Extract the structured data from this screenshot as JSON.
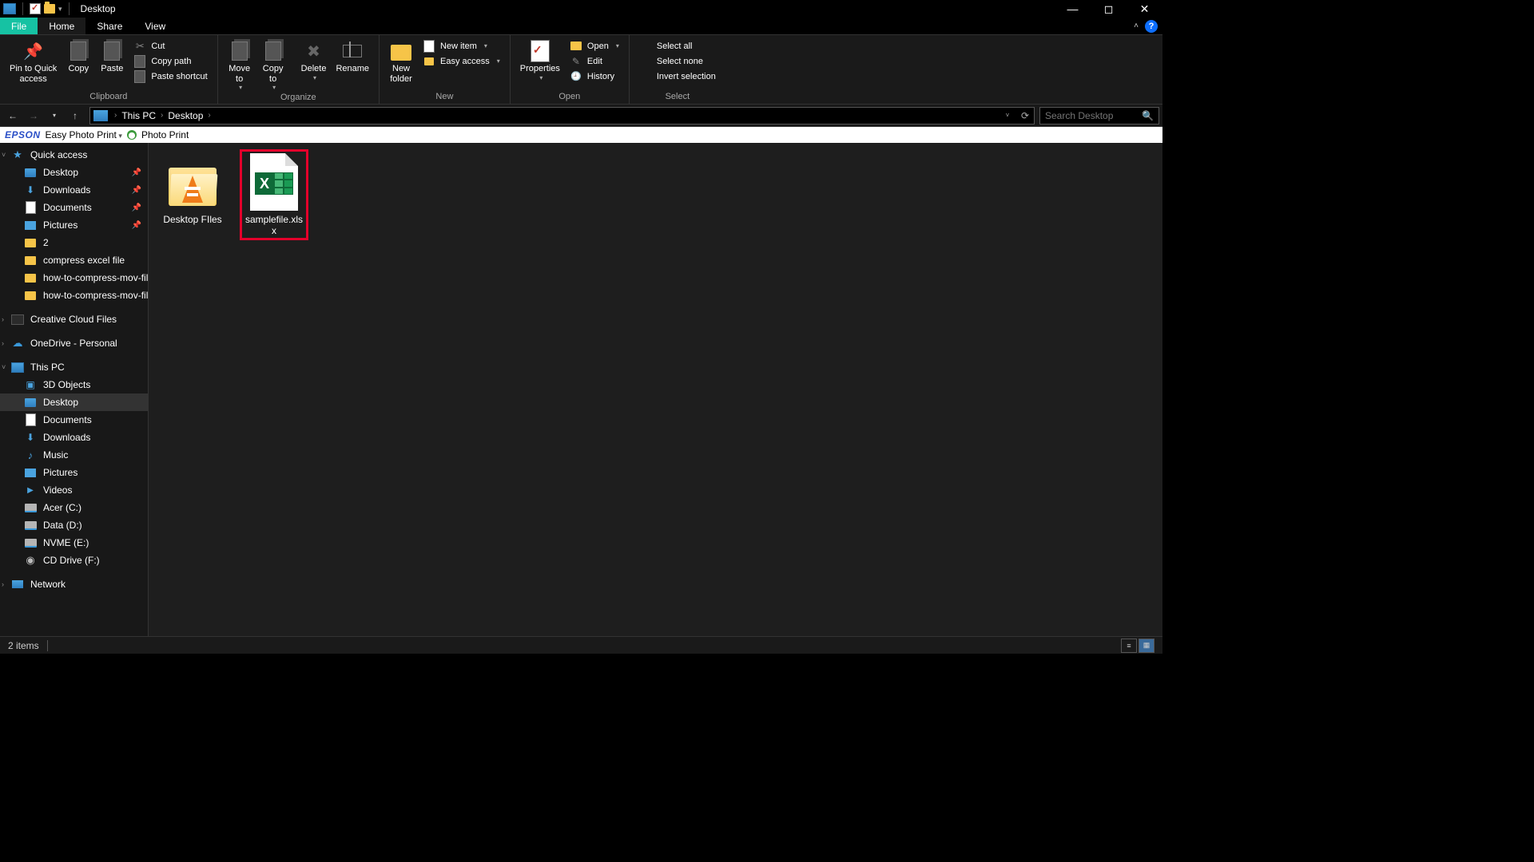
{
  "window": {
    "title": "Desktop"
  },
  "tabs": {
    "file": "File",
    "home": "Home",
    "share": "Share",
    "view": "View"
  },
  "ribbon": {
    "clipboard": {
      "label": "Clipboard",
      "pin": "Pin to Quick\naccess",
      "copy": "Copy",
      "paste": "Paste",
      "cut": "Cut",
      "copypath": "Copy path",
      "pasteshortcut": "Paste shortcut"
    },
    "organize": {
      "label": "Organize",
      "moveto": "Move\nto",
      "copyto": "Copy\nto",
      "delete": "Delete",
      "rename": "Rename"
    },
    "new": {
      "label": "New",
      "newfolder": "New\nfolder",
      "newitem": "New item",
      "easyaccess": "Easy access"
    },
    "open": {
      "label": "Open",
      "properties": "Properties",
      "open": "Open",
      "edit": "Edit",
      "history": "History"
    },
    "select": {
      "label": "Select",
      "all": "Select all",
      "none": "Select none",
      "invert": "Invert selection"
    }
  },
  "address": {
    "thispc": "This PC",
    "desktop": "Desktop",
    "search_placeholder": "Search Desktop"
  },
  "epson": {
    "brand": "EPSON",
    "easy": "Easy Photo Print",
    "print": "Photo Print"
  },
  "nav": {
    "quick": "Quick access",
    "desktop": "Desktop",
    "downloads": "Downloads",
    "documents": "Documents",
    "pictures": "Pictures",
    "two": "2",
    "compress": "compress excel file",
    "mov1": "how-to-compress-mov-file",
    "mov2": "how-to-compress-mov-file",
    "cc": "Creative Cloud Files",
    "onedrive": "OneDrive - Personal",
    "thispc": "This PC",
    "obj3d": "3D Objects",
    "pc_desktop": "Desktop",
    "pc_documents": "Documents",
    "pc_downloads": "Downloads",
    "music": "Music",
    "pc_pictures": "Pictures",
    "videos": "Videos",
    "acer": "Acer (C:)",
    "data": "Data (D:)",
    "nvme": "NVME (E:)",
    "cd": "CD Drive (F:)",
    "network": "Network"
  },
  "files": {
    "folder": "Desktop FIles",
    "excel": "samplefile.xlsx"
  },
  "status": {
    "items": "2 items"
  }
}
